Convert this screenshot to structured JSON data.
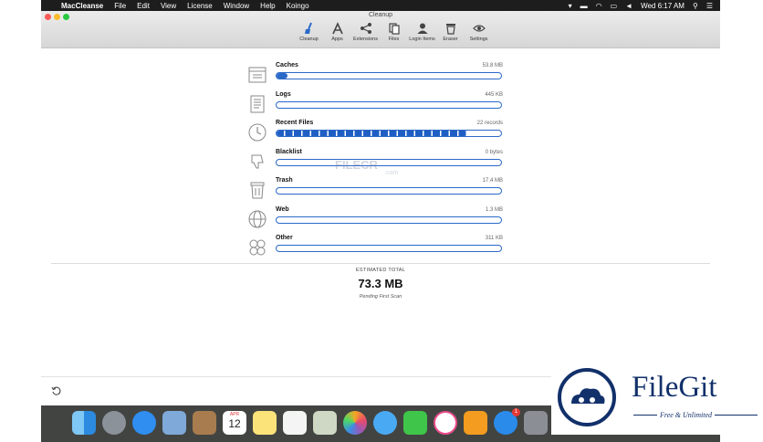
{
  "menubar": {
    "apple": "",
    "app_name": "MacCleanse",
    "menus": [
      "File",
      "Edit",
      "View",
      "License",
      "Window",
      "Help",
      "Koingo"
    ],
    "clock": "Wed 6:17 AM"
  },
  "window": {
    "title": "Cleanup",
    "toolbar": [
      {
        "label": "Cleanup",
        "icon": "broom-icon"
      },
      {
        "label": "Apps",
        "icon": "apps-icon"
      },
      {
        "label": "Extensions",
        "icon": "share-icon"
      },
      {
        "label": "Files",
        "icon": "files-icon"
      },
      {
        "label": "Login Items",
        "icon": "user-icon"
      },
      {
        "label": "Eraser",
        "icon": "trash-icon"
      },
      {
        "label": "Settings",
        "icon": "eye-icon"
      }
    ]
  },
  "categories": [
    {
      "name": "Caches",
      "size": "53.8 MB",
      "fill": 0.05,
      "icon": "caches-box-icon"
    },
    {
      "name": "Logs",
      "size": "445 KB",
      "fill": 0.0,
      "icon": "logs-document-icon"
    },
    {
      "name": "Recent Files",
      "size": "22 records",
      "fill": 0.85,
      "segmented": true,
      "icon": "recent-clock-icon"
    },
    {
      "name": "Blacklist",
      "size": "0 bytes",
      "fill": 0.0,
      "icon": "thumbs-down-icon"
    },
    {
      "name": "Trash",
      "size": "17.4 MB",
      "fill": 0.0,
      "icon": "trash-can-icon"
    },
    {
      "name": "Web",
      "size": "1.3 MB",
      "fill": 0.0,
      "icon": "globe-icon"
    },
    {
      "name": "Other",
      "size": "311 KB",
      "fill": 0.0,
      "icon": "grid-icon"
    }
  ],
  "summary": {
    "label": "ESTIMATED TOTAL",
    "value": "73.3 MB",
    "status": "Pending First Scan"
  },
  "watermark": {
    "text": "FILECR",
    "suffix": ".com"
  },
  "dock": {
    "apps": [
      "Finder",
      "Launchpad",
      "Safari",
      "Mail",
      "Contacts",
      "Calendar",
      "Notes",
      "Reminders",
      "Preview",
      "Photos",
      "Messages",
      "FaceTime",
      "iTunes",
      "iBooks",
      "App Store",
      "System Preferences"
    ],
    "calendar_day": "12",
    "calendar_month": "APR",
    "appstore_badge": "1"
  },
  "filegit": {
    "title": "FileGit",
    "subtitle": "Free & Unlimited"
  }
}
